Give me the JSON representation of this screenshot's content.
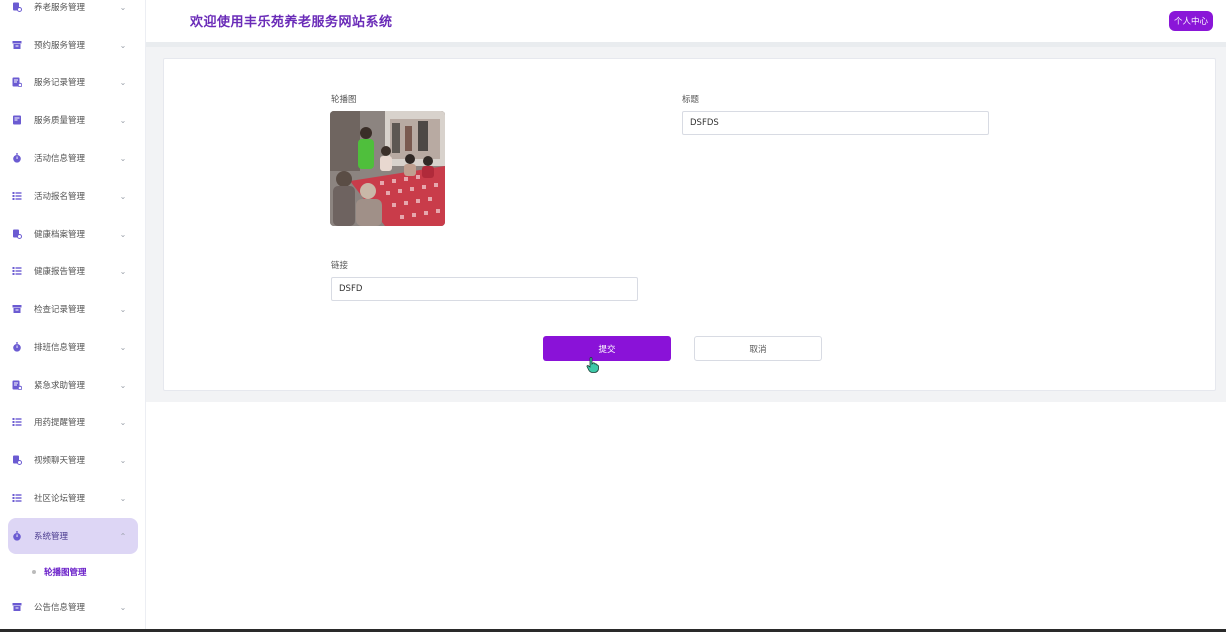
{
  "app": {
    "title": "欢迎使用丰乐苑养老服务网站系统",
    "user_center_label": "个人中心",
    "accent_color": "#8a12d8"
  },
  "sidebar": {
    "items": [
      {
        "label": "养老服务管理",
        "icon": "file-user-icon",
        "expanded": false
      },
      {
        "label": "预约服务管理",
        "icon": "archive-icon",
        "expanded": false
      },
      {
        "label": "服务记录管理",
        "icon": "edit-doc-icon",
        "expanded": false
      },
      {
        "label": "服务质量管理",
        "icon": "doc-icon",
        "expanded": false
      },
      {
        "label": "活动信息管理",
        "icon": "stopwatch-icon",
        "expanded": false
      },
      {
        "label": "活动报名管理",
        "icon": "list-icon",
        "expanded": false
      },
      {
        "label": "健康档案管理",
        "icon": "file-user-icon",
        "expanded": false
      },
      {
        "label": "健康报告管理",
        "icon": "list-icon",
        "expanded": false
      },
      {
        "label": "检查记录管理",
        "icon": "archive-icon",
        "expanded": false
      },
      {
        "label": "排班信息管理",
        "icon": "stopwatch-icon",
        "expanded": false
      },
      {
        "label": "紧急求助管理",
        "icon": "edit-doc-icon",
        "expanded": false
      },
      {
        "label": "用药提醒管理",
        "icon": "list-icon",
        "expanded": false
      },
      {
        "label": "视频聊天管理",
        "icon": "file-user-icon",
        "expanded": false
      },
      {
        "label": "社区论坛管理",
        "icon": "list-icon",
        "expanded": false
      },
      {
        "label": "系统管理",
        "icon": "stopwatch-icon",
        "expanded": true
      },
      {
        "label": "公告信息管理",
        "icon": "archive-icon",
        "expanded": false
      }
    ],
    "sub_item": "轮播图管理"
  },
  "form": {
    "image_label": "轮播图",
    "title_label": "标题",
    "title_value": "DSFDS",
    "link_label": "链接",
    "link_value": "DSFD",
    "submit_label": "提交",
    "cancel_label": "取消"
  }
}
